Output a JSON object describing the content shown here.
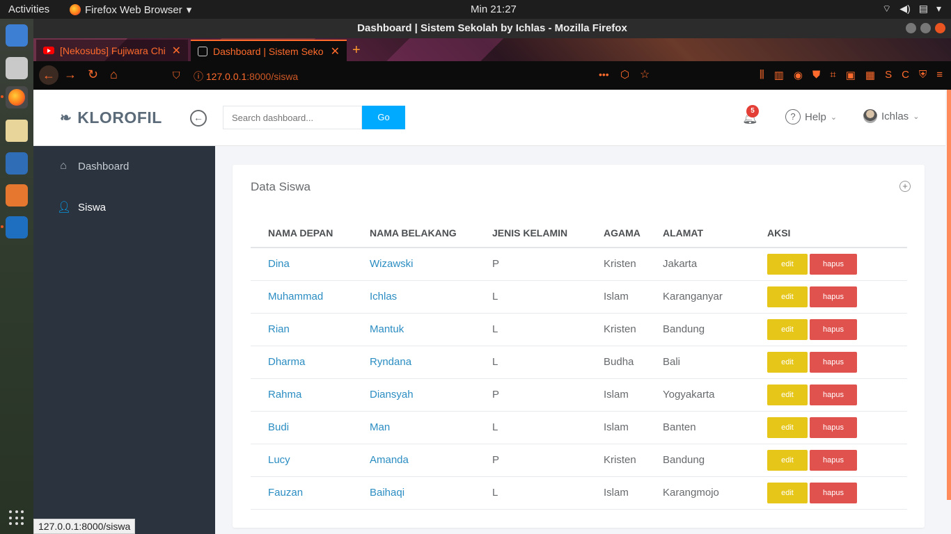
{
  "topbar": {
    "activities": "Activities",
    "app_name": "Firefox Web Browser",
    "clock": "Min 21:27"
  },
  "window": {
    "title": "Dashboard | Sistem Sekolah by Ichlas - Mozilla Firefox"
  },
  "tabs": [
    {
      "label": "[Nekosubs] Fujiwara Chi",
      "icon": "youtube-icon"
    },
    {
      "label": "Dashboard | Sistem Seko",
      "icon": "leaf-icon"
    }
  ],
  "browser": {
    "url_host": "127.0.0.1",
    "url_path": ":8000/siswa"
  },
  "header": {
    "brand": "KLOROFIL",
    "search_placeholder": "Search dashboard...",
    "go_label": "Go",
    "notification_count": "5",
    "help_label": "Help",
    "user_name": "Ichlas"
  },
  "sidebar": {
    "items": [
      {
        "label": "Dashboard",
        "icon": "home-icon"
      },
      {
        "label": "Siswa",
        "icon": "user-icon"
      }
    ]
  },
  "panel": {
    "title": "Data Siswa"
  },
  "table": {
    "columns": [
      "NAMA DEPAN",
      "NAMA BELAKANG",
      "JENIS KELAMIN",
      "AGAMA",
      "ALAMAT",
      "AKSI"
    ],
    "rows": [
      {
        "depan": "Dina",
        "belakang": "Wizawski",
        "jk": "P",
        "agama": "Kristen",
        "alamat": "Jakarta"
      },
      {
        "depan": "Muhammad",
        "belakang": "Ichlas",
        "jk": "L",
        "agama": "Islam",
        "alamat": "Karanganyar"
      },
      {
        "depan": "Rian",
        "belakang": "Mantuk",
        "jk": "L",
        "agama": "Kristen",
        "alamat": "Bandung"
      },
      {
        "depan": "Dharma",
        "belakang": "Ryndana",
        "jk": "L",
        "agama": "Budha",
        "alamat": "Bali"
      },
      {
        "depan": "Rahma",
        "belakang": "Diansyah",
        "jk": "P",
        "agama": "Islam",
        "alamat": "Yogyakarta"
      },
      {
        "depan": "Budi",
        "belakang": "Man",
        "jk": "L",
        "agama": "Islam",
        "alamat": "Banten"
      },
      {
        "depan": "Lucy",
        "belakang": "Amanda",
        "jk": "P",
        "agama": "Kristen",
        "alamat": "Bandung"
      },
      {
        "depan": "Fauzan",
        "belakang": "Baihaqi",
        "jk": "L",
        "agama": "Islam",
        "alamat": "Karangmojo"
      }
    ],
    "edit_label": "edit",
    "delete_label": "hapus"
  },
  "status_bar": {
    "text": "127.0.0.1:8000/siswa"
  },
  "colors": {
    "accent": "#00aaff",
    "sidebar_bg": "#2b333e",
    "edit_btn": "#e6c619",
    "delete_btn": "#e0524e",
    "link": "#2b8dc2",
    "browser_accent": "#ff6b2c"
  }
}
